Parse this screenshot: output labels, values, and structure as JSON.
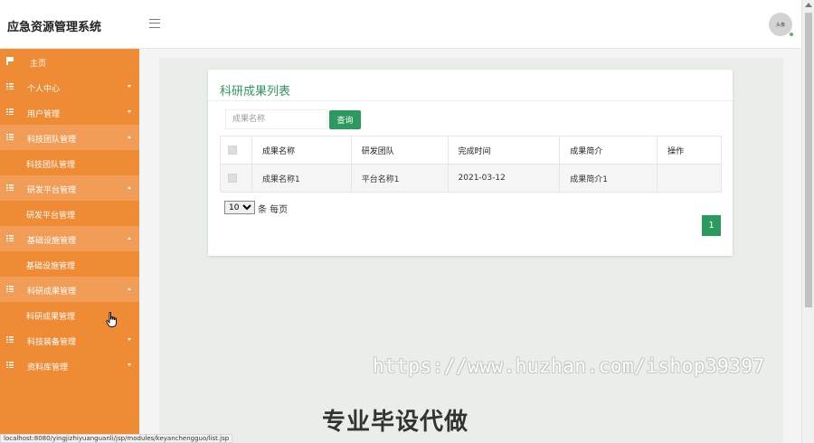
{
  "header": {
    "app_title": "应急资源管理系统",
    "avatar_text": "头像"
  },
  "sidebar": {
    "items": [
      {
        "label": "主页",
        "icon": "flag-icon"
      },
      {
        "label": "个人中心",
        "icon": "grid-icon",
        "caret": "down"
      },
      {
        "label": "用户管理",
        "icon": "grid-icon",
        "caret": "down"
      },
      {
        "label": "科技团队管理",
        "icon": "grid-icon",
        "caret": "up",
        "open": true
      },
      {
        "label": "科技团队管理",
        "sub": true
      },
      {
        "label": "研发平台管理",
        "icon": "grid-icon",
        "caret": "up",
        "open": true
      },
      {
        "label": "研发平台管理",
        "sub": true
      },
      {
        "label": "基础设施管理",
        "icon": "grid-icon",
        "caret": "up",
        "open": true
      },
      {
        "label": "基础设施管理",
        "sub": true
      },
      {
        "label": "科研成果管理",
        "icon": "grid-icon",
        "caret": "up",
        "open": true
      },
      {
        "label": "科研成果管理",
        "sub": true
      },
      {
        "label": "科技装备管理",
        "icon": "grid-icon",
        "caret": "down"
      },
      {
        "label": "资料库管理",
        "icon": "grid-icon",
        "caret": "down"
      }
    ]
  },
  "card": {
    "title": "科研成果列表",
    "search_placeholder": "成果名称",
    "search_button": "查询"
  },
  "table": {
    "columns": [
      "成果名称",
      "研发团队",
      "完成时间",
      "成果简介",
      "操作"
    ],
    "rows": [
      [
        "成果名称1",
        "平台名称1",
        "2021-03-12",
        "成果简介1",
        ""
      ]
    ]
  },
  "pagination": {
    "page_size": "10",
    "page_size_options": [
      "10"
    ],
    "page_size_label": "条 每页",
    "current_page": "1"
  },
  "watermark": {
    "url": "https://www.huzhan.com/ishop39397",
    "text": "专业毕设代做"
  },
  "status_bar": {
    "url": "localhost:8080/yingjizhiyuanguanli/jsp/modules/keyanchengguo/list.jsp"
  },
  "colors": {
    "sidebar": "#ef8a35",
    "sidebar_open": "#f19d57",
    "accent": "#2c9a5e"
  }
}
